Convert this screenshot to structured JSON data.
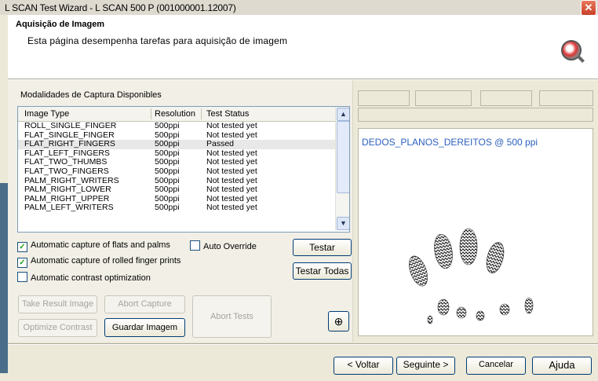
{
  "window": {
    "title": "L SCAN Test Wizard - L SCAN 500 P (001000001.12007)",
    "close_glyph": "✕"
  },
  "header": {
    "title": "Aquisição de Imagem",
    "subtitle": "Esta página desempenha tarefas para aquisição de imagem",
    "icon": "magnifier-icon"
  },
  "modalities": {
    "label": "Modalidades de Captura Disponibles",
    "columns": [
      "Image Type",
      "Resolution",
      "Test Status"
    ],
    "rows": [
      {
        "type": "ROLL_SINGLE_FINGER",
        "res": "500ppi",
        "status": "Not tested yet"
      },
      {
        "type": "FLAT_SINGLE_FINGER",
        "res": "500ppi",
        "status": "Not tested yet"
      },
      {
        "type": "FLAT_RIGHT_FINGERS",
        "res": "500ppi",
        "status": "Passed"
      },
      {
        "type": "FLAT_LEFT_FINGERS",
        "res": "500ppi",
        "status": "Not tested yet"
      },
      {
        "type": "FLAT_TWO_THUMBS",
        "res": "500ppi",
        "status": "Not tested yet"
      },
      {
        "type": "FLAT_TWO_FINGERS",
        "res": "500ppi",
        "status": "Not tested yet"
      },
      {
        "type": "PALM_RIGHT_WRITERS",
        "res": "500ppi",
        "status": "Not tested yet"
      },
      {
        "type": "PALM_RIGHT_LOWER",
        "res": "500ppi",
        "status": "Not tested yet"
      },
      {
        "type": "PALM_RIGHT_UPPER",
        "res": "500ppi",
        "status": "Not tested yet"
      },
      {
        "type": "PALM_LEFT_WRITERS",
        "res": "500ppi",
        "status": "Not tested yet"
      }
    ],
    "selected_index": 2
  },
  "options": {
    "auto_flats": {
      "label": "Automatic capture of flats and palms",
      "checked": true
    },
    "auto_override": {
      "label": "Auto Override",
      "checked": false
    },
    "auto_rolled": {
      "label": "Automatic capture of rolled finger prints",
      "checked": true
    },
    "auto_contrast": {
      "label": "Automatic  contrast optimization",
      "checked": false
    }
  },
  "buttons": {
    "testar": "Testar",
    "testar_todas": "Testar Todas",
    "take_result": "Take Result Image",
    "abort_capture": "Abort Capture",
    "abort_tests": "Abort Tests",
    "optimize_contrast": "Optimize Contrast",
    "guardar_imagem": "Guardar Imagem",
    "zoom_icon": "zoom-in-icon"
  },
  "preview": {
    "caption": "DEDOS_PLANOS_DEREITOS @ 500 ppi"
  },
  "nav": {
    "back": "< Voltar",
    "next": "Seguinte >",
    "cancel": "Cancelar",
    "help": "Ajuda"
  }
}
